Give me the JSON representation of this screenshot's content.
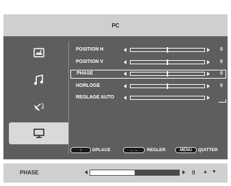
{
  "menu": {
    "title": "PC"
  },
  "nav": {
    "items": [
      {
        "icon": "picture-icon"
      },
      {
        "icon": "music-note-icon"
      },
      {
        "icon": "satellite-dish-icon"
      },
      {
        "icon": "monitor-icon",
        "selected": true
      }
    ]
  },
  "settings": [
    {
      "label": "POSITION H",
      "value": "0",
      "level": 0.5
    },
    {
      "label": "POSITION V",
      "value": "0",
      "level": 0.5
    },
    {
      "label": "PHASE",
      "value": "0",
      "level": 0.5,
      "selected": true
    },
    {
      "label": "HORLOGE",
      "value": "0",
      "level": 0.5
    },
    {
      "label": "REGLAGE AUTO",
      "value": "",
      "level": null
    }
  ],
  "legend": {
    "move_key": "↕",
    "move_label": "DPLACE",
    "adjust_key": "←→",
    "adjust_label": "REGLER",
    "menu_key": "MENU",
    "exit_label": "QUITTER"
  },
  "status": {
    "label": "PHASE",
    "value": "0",
    "level": 0.5,
    "updown": "▲ ▼"
  },
  "colors": {
    "osd_background": "#5e5e5e",
    "header_background": "#cfcfcf",
    "selected_tab": "#d9d9d9",
    "text": "#ffffff"
  }
}
